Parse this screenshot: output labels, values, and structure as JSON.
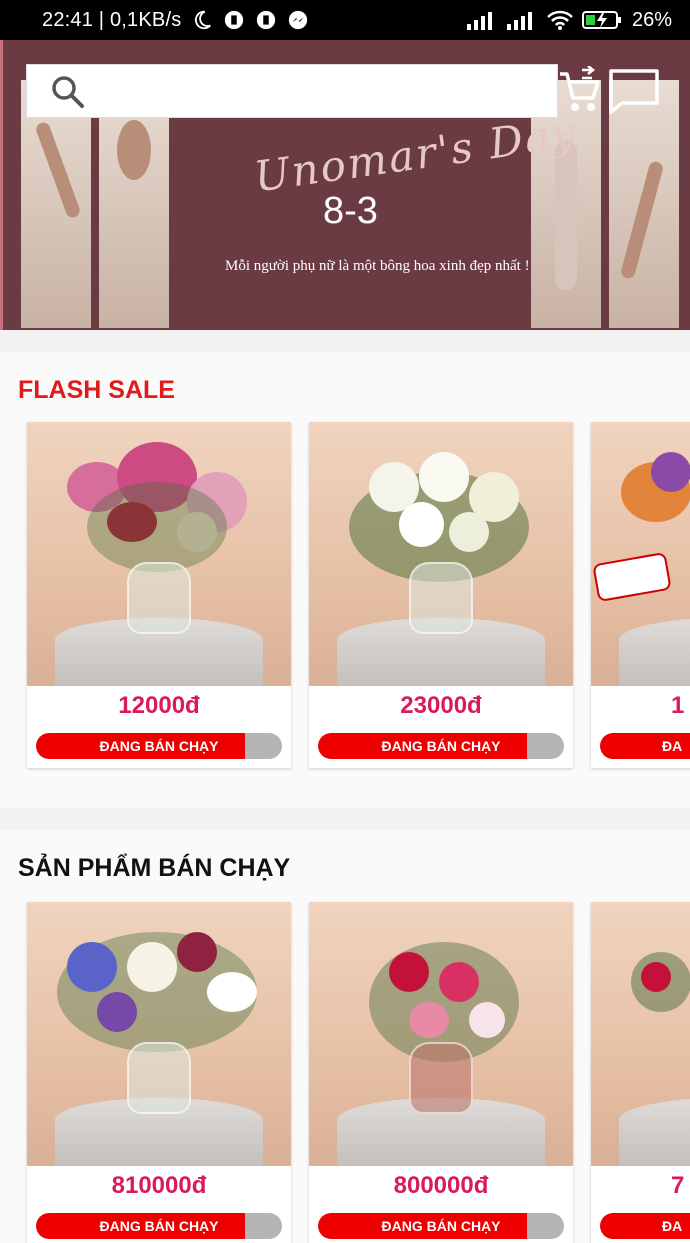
{
  "status_bar": {
    "time": "22:41 | 0,1KB/s",
    "battery": "26%"
  },
  "banner": {
    "script_text": "Unomar's Day",
    "date": "8-3",
    "tagline": "Mỗi người phụ nữ là một bông hoa xinh đẹp nhất !"
  },
  "search": {
    "placeholder": ""
  },
  "flash_sale": {
    "title": "FLASH SALE",
    "products": [
      {
        "price": "12000đ",
        "badge": "ĐANG BÁN CHẠY",
        "sold_fraction": 0.85
      },
      {
        "price": "23000đ",
        "badge": "ĐANG BÁN CHẠY",
        "sold_fraction": 0.85
      },
      {
        "price": "1",
        "badge": "ĐA",
        "sold_fraction": 0.85
      }
    ]
  },
  "best_sellers": {
    "title": "SẢN PHẨM BÁN CHẠY",
    "products": [
      {
        "price": "810000đ",
        "badge": "ĐANG BÁN CHẠY",
        "sold_fraction": 0.85
      },
      {
        "price": "800000đ",
        "badge": "ĐANG BÁN CHẠY",
        "sold_fraction": 0.85
      },
      {
        "price": "7",
        "badge": "ĐA",
        "sold_fraction": 0.85
      }
    ]
  },
  "colors": {
    "section_title_flash": "#e01b1b",
    "price": "#d81b60",
    "bar_fill": "#ef0000",
    "bar_track": "#b5b5b5",
    "banner_bg": "#6b3b43"
  }
}
